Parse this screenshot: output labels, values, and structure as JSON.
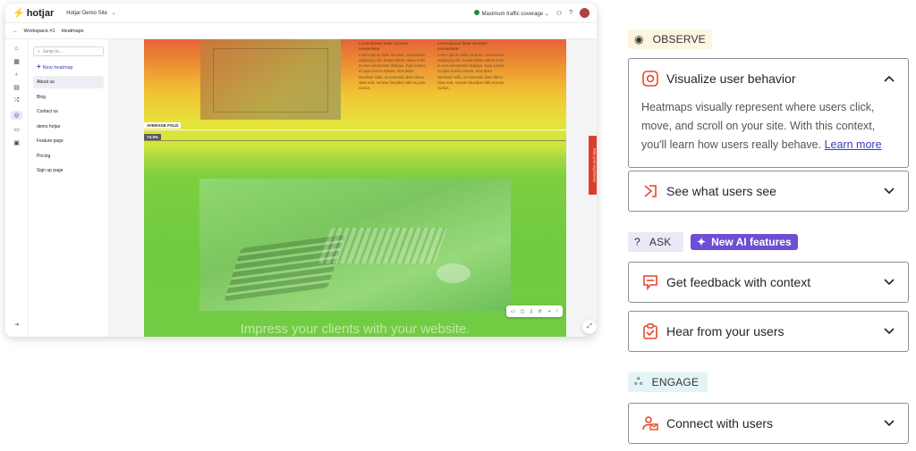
{
  "app": {
    "logo_text": "hotjar",
    "site_name": "Hotjar Demo Site",
    "traffic_label": "Maximum traffic coverage",
    "breadcrumb": {
      "workspace": "Workspace #1",
      "section": "Heatmaps"
    },
    "search_placeholder": "Jump to...",
    "new_heatmap_label": "New heatmap",
    "nav_items": [
      "About us",
      "Blog",
      "Contact us",
      "demo hotjar",
      "Feature page",
      "Pricing",
      "Sign up page"
    ],
    "selected_nav": "About us",
    "lorem_heading": "Lorem ipsum dolor sit amet consectetur",
    "lorem_body": "Lorem ipsum dolor sit amet, consectetur adipiscing elit. Suspendisse varius enim in eros elementum tristique. Duis cursus, mi quis viverra ornare, eros dolor interdum nulla, ut commodo diam libero vitae erat. Aenean faucibus nibh et justo cursus.",
    "average_fold_label": "AVERAGE FOLD",
    "fold_percent": "73.3%",
    "impress_text": "Impress your clients with your website.",
    "feedback_tab_label": "Rate your experience"
  },
  "panel": {
    "observe_label": "OBSERVE",
    "ask_label": "ASK",
    "ai_badge": "New AI features",
    "engage_label": "ENGAGE",
    "cards": {
      "visualize": {
        "title": "Visualize user behavior",
        "body": "Heatmaps visually represent where users click, move, and scroll on your site. With this context, you'll learn how users really behave.",
        "link": "Learn more",
        "expanded": true
      },
      "see": {
        "title": "See what users see",
        "expanded": false
      },
      "feedback": {
        "title": "Get feedback with context",
        "expanded": false
      },
      "hear": {
        "title": "Hear from your users",
        "expanded": false
      },
      "connect": {
        "title": "Connect with users",
        "expanded": false
      }
    }
  },
  "colors": {
    "accent": "#e8472a",
    "ai_purple": "#6d4fd6",
    "heat_green": "#6fcb40",
    "heat_red": "#e66337"
  }
}
